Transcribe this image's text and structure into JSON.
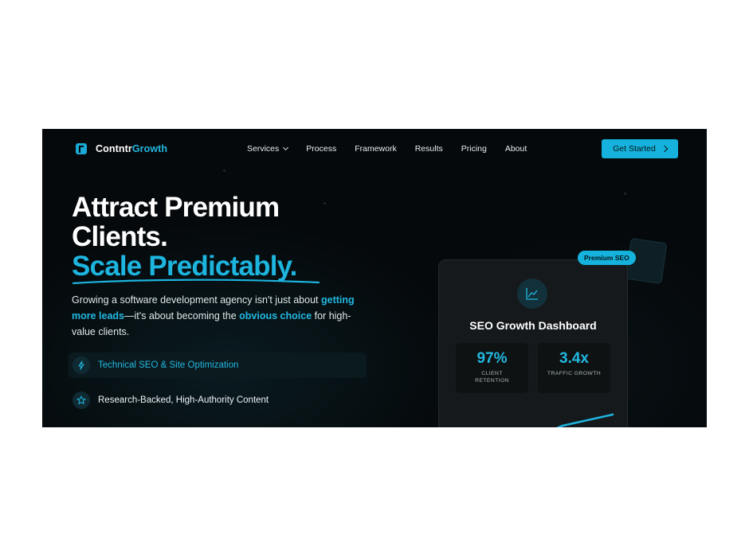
{
  "brand": {
    "name_part1": "Contntr",
    "name_part2": "Growth"
  },
  "nav": {
    "items": [
      {
        "label": "Services",
        "has_dropdown": true
      },
      {
        "label": "Process"
      },
      {
        "label": "Framework"
      },
      {
        "label": "Results"
      },
      {
        "label": "Pricing"
      },
      {
        "label": "About"
      }
    ],
    "cta_label": "Get Started"
  },
  "hero": {
    "line1": "Attract Premium",
    "line2": "Clients.",
    "line3": "Scale Predictably.",
    "para": {
      "t1": "Growing a software development agency isn't just about ",
      "h1": "getting more leads",
      "t2": "—it's about becoming the ",
      "h2": "obvious choice",
      "t3": " for high-value clients."
    },
    "features": [
      {
        "label": "Technical SEO & Site Optimization",
        "icon": "lightning-icon",
        "active": true
      },
      {
        "label": "Research-Backed, High-Authority Content",
        "icon": "star-icon",
        "active": false
      }
    ]
  },
  "dashboard": {
    "badge": "Premium SEO",
    "title": "SEO Growth Dashboard",
    "icon": "line-chart-icon",
    "stats": [
      {
        "value": "97%",
        "label_line1": "CLIENT",
        "label_line2": "RETENTION"
      },
      {
        "value": "3.4x",
        "label_line1": "TRAFFIC GROWTH",
        "label_line2": ""
      }
    ]
  },
  "colors": {
    "accent": "#1db4de",
    "background": "#05090b",
    "card": "#15191b"
  }
}
